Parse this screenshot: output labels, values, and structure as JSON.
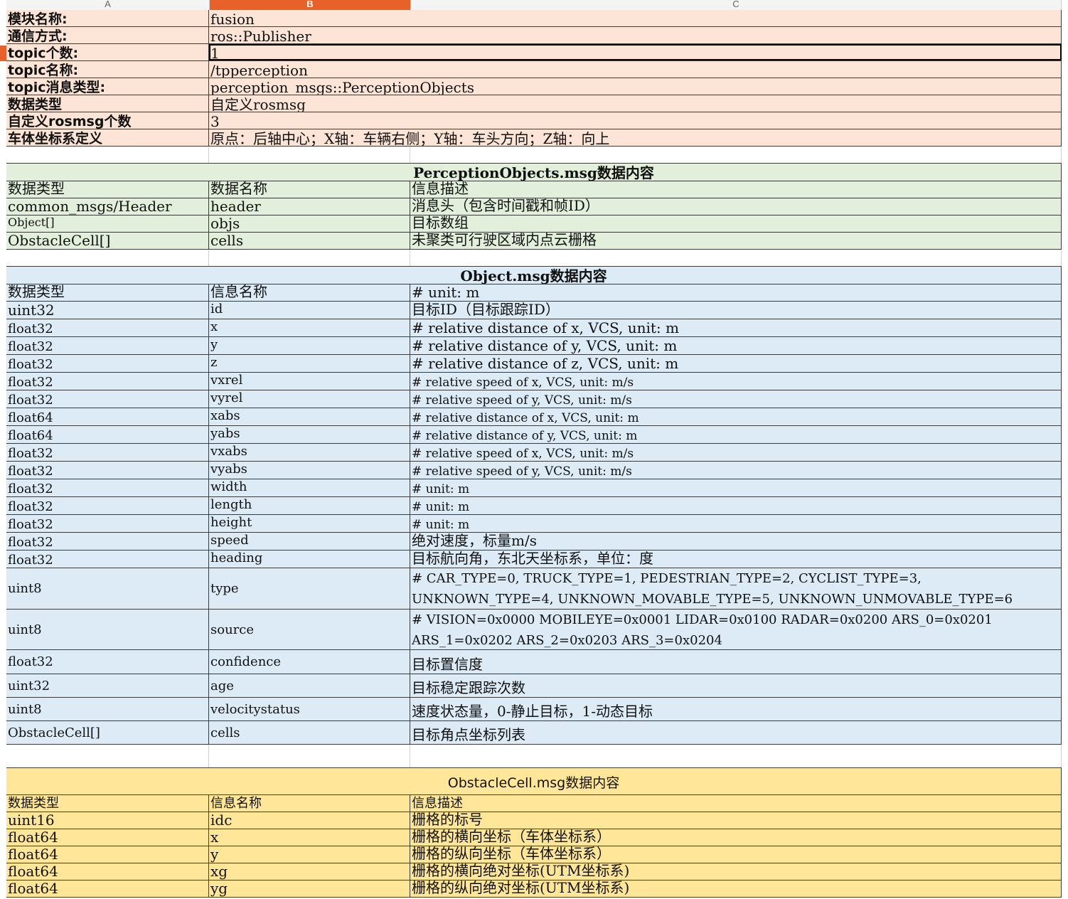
{
  "columns": [
    "A",
    "B",
    "C"
  ],
  "info_rows": [
    {
      "label": "模块名称:",
      "value": "fusion"
    },
    {
      "label": "通信方式:",
      "value": "ros::Publisher"
    },
    {
      "label": "topic个数:",
      "value": "1"
    },
    {
      "label": "topic名称:",
      "value": "/tpperception"
    },
    {
      "label": "topic消息类型:",
      "value": "perception_msgs::PerceptionObjects"
    },
    {
      "label": "数据类型",
      "value": "自定义rosmsg"
    },
    {
      "label": "自定义rosmsg个数",
      "value": "3"
    },
    {
      "label": "车体坐标系定义",
      "value": "原点：后轴中心；X轴：车辆右侧；Y轴：车头方向；Z轴：向上"
    }
  ],
  "perception_table": {
    "title": "PerceptionObjects.msg数据内容",
    "headers": [
      "数据类型",
      "数据名称",
      "信息描述"
    ],
    "rows": [
      [
        "common_msgs/Header",
        "header",
        "消息头（包含时间戳和帧ID）"
      ],
      [
        "Object[]",
        "objs",
        "目标数组"
      ],
      [
        "ObstacleCell[]",
        "cells",
        "未聚类可行驶区域内点云栅格"
      ]
    ]
  },
  "object_table": {
    "title": "Object.msg数据内容",
    "headers": [
      "数据类型",
      "信息名称",
      "# unit: m"
    ],
    "rows": [
      [
        "uint32",
        "id",
        "目标ID（目标跟踪ID）"
      ],
      [
        "float32",
        "x",
        "# relative distance of x, VCS, unit: m"
      ],
      [
        "float32",
        "y",
        "# relative distance of y, VCS, unit: m"
      ],
      [
        "float32",
        "z",
        "# relative distance of z, VCS, unit: m"
      ],
      [
        "float32",
        "vxrel",
        "# relative speed of x, VCS, unit: m/s"
      ],
      [
        "float32",
        "vyrel",
        "# relative speed of y, VCS, unit: m/s"
      ],
      [
        "float64",
        "xabs",
        "# relative distance of x, VCS, unit: m"
      ],
      [
        "float64",
        "yabs",
        "# relative distance of y, VCS, unit: m"
      ],
      [
        "float32",
        "vxabs",
        "# relative speed of x, VCS, unit: m/s"
      ],
      [
        "float32",
        "vyabs",
        "# relative speed of y, VCS, unit: m/s"
      ],
      [
        "float32",
        "width",
        "# unit: m"
      ],
      [
        "float32",
        "length",
        "# unit: m"
      ],
      [
        "float32",
        "height",
        "# unit: m"
      ],
      [
        "float32",
        "speed",
        "绝对速度，标量m/s"
      ],
      [
        "float32",
        "heading",
        "目标航向角，东北天坐标系，单位：度"
      ],
      [
        "uint8",
        "type",
        "# CAR_TYPE=0, TRUCK_TYPE=1, PEDESTRIAN_TYPE=2, CYCLIST_TYPE=3, UNKNOWN_TYPE=4, UNKNOWN_MOVABLE_TYPE=5, UNKNOWN_UNMOVABLE_TYPE=6"
      ],
      [
        "uint8",
        "source",
        "# VISION=0x0000 MOBILEYE=0x0001 LIDAR=0x0100 RADAR=0x0200 ARS_0=0x0201   ARS_1=0x0202 ARS_2=0x0203  ARS_3=0x0204"
      ],
      [
        "float32",
        "confidence",
        "目标置信度"
      ],
      [
        "uint32",
        "age",
        "目标稳定跟踪次数"
      ],
      [
        "uint8",
        "velocitystatus",
        "速度状态量，0-静止目标，1-动态目标"
      ],
      [
        "ObstacleCell[]",
        "cells",
        "目标角点坐标列表"
      ]
    ]
  },
  "obstacle_table": {
    "title": "ObstacleCell.msg数据内容",
    "headers": [
      "数据类型",
      "信息名称",
      "信息描述"
    ],
    "rows": [
      [
        "uint16",
        "idc",
        "栅格的标号"
      ],
      [
        "float64",
        "x",
        "栅格的横向坐标（车体坐标系）"
      ],
      [
        "float64",
        "y",
        "栅格的纵向坐标（车体坐标系）"
      ],
      [
        "float64",
        "xg",
        "栅格的横向绝对坐标(UTM坐标系)"
      ],
      [
        "float64",
        "yg",
        "栅格的纵向绝对坐标(UTM坐标系)"
      ]
    ]
  }
}
